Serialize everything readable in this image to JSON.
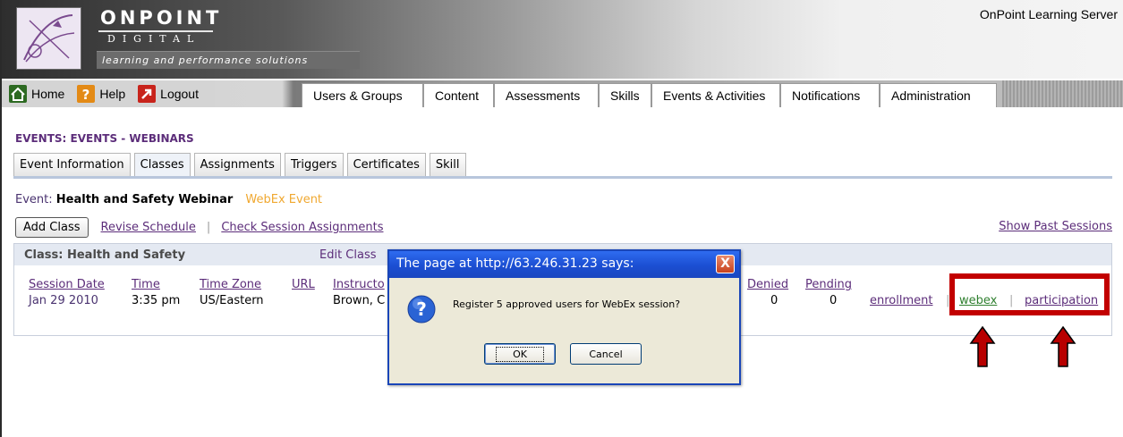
{
  "header": {
    "brand_title": "ONPOINT",
    "brand_sub": "DIGITAL",
    "brand_tag": "learning and performance solutions",
    "server_name": "OnPoint Learning Server"
  },
  "nav": {
    "home": "Home",
    "help": "Help",
    "logout": "Logout",
    "tabs": [
      "Users & Groups",
      "Content",
      "Assessments",
      "Skills",
      "Events & Activities",
      "Notifications",
      "Administration"
    ]
  },
  "page": {
    "title": "EVENTS: EVENTS - WEBINARS",
    "sub_tabs": [
      "Event Information",
      "Classes",
      "Assignments",
      "Triggers",
      "Certificates",
      "Skill"
    ],
    "active_sub_tab": "Classes",
    "event_label": "Event:",
    "event_name": "Health and Safety Webinar",
    "event_tag": "WebEx Event",
    "add_class": "Add Class",
    "revise_schedule": "Revise Schedule",
    "separator": "|",
    "check_sessions": "Check Session Assignments",
    "show_past": "Show Past Sessions"
  },
  "class_box": {
    "title": "Class: Health and Safety",
    "edit": "Edit Class",
    "headers": {
      "session_date": "Session Date",
      "time": "Time",
      "time_zone": "Time Zone",
      "url": "URL",
      "instructor": "Instructo",
      "denied": "Denied",
      "pending": "Pending"
    },
    "row": {
      "session_date": "Jan 29 2010",
      "time": "3:35 pm",
      "time_zone": "US/Eastern",
      "instructor": "Brown, C",
      "denied": "0",
      "pending": "0"
    },
    "links": {
      "enrollment": "enrollment",
      "webex": "webex",
      "participation": "participation",
      "sep": "|"
    }
  },
  "dialog": {
    "title": "The page at http://63.246.31.23 says:",
    "close": "X",
    "message": "Register 5 approved users for WebEx session?",
    "ok": "OK",
    "cancel": "Cancel"
  },
  "colors": {
    "accent_purple": "#5c2d7a",
    "highlight_red": "#c20000",
    "event_tag_orange": "#f0a830",
    "dialog_blue": "#1b4ed2"
  },
  "icons": {
    "home": "home-icon",
    "help": "help-icon",
    "logout": "logout-icon",
    "dialog": "question-icon",
    "arrows": "red-up-arrow-icon"
  }
}
